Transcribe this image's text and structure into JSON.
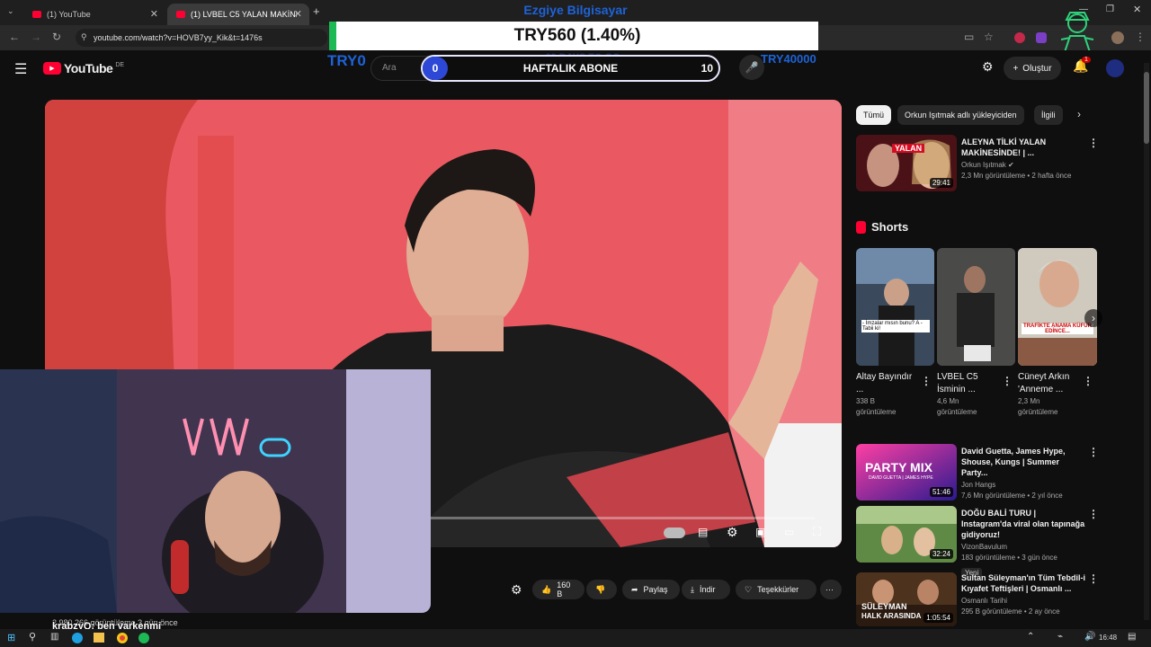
{
  "tabs": [
    {
      "label": "(1) YouTube"
    },
    {
      "label": "(1) LVBEL C5 YALAN MAKİNESİNE..."
    }
  ],
  "address": {
    "url": "youtube.com/watch?v=HOVB7yy_Kik&t=1476s"
  },
  "overlay": {
    "title": "Ezgiye Bilgisayar",
    "donation": "TRY560 (1.40%)",
    "try_left": "TRY0",
    "try_right": "TRY40000",
    "days_left": "69 DAYS TO GO",
    "subs_label": "HAFTALIK ABONE",
    "subs_current": "0",
    "subs_goal": "10"
  },
  "header": {
    "logo": "YouTube",
    "region": "DE",
    "search_placeholder": "Ara",
    "create_label": "Oluştur",
    "notif_count": "1"
  },
  "player": {
    "views_line": "2.980.266 görüntüleme  3 gün önce"
  },
  "actions": {
    "likes": "160 B",
    "share": "Paylaş",
    "download": "İndir",
    "thanks": "Teşekkürler"
  },
  "chips": [
    "Tümü",
    "Orkun Işıtmak adlı yükleyiciden",
    "İlgili"
  ],
  "recs_top": {
    "title": "ALEYNA TİLKİ YALAN MAKİNESİNDE! | ...",
    "channel": "Orkun Işıtmak",
    "meta": "2,3 Mn görüntüleme • 2 hafta önce",
    "duration": "29:41",
    "thumb_text": "YALAN"
  },
  "shorts": {
    "heading": "Shorts",
    "items": [
      {
        "title": "Altay Bayındır ...",
        "views": "338 B",
        "views_label": "görüntüleme",
        "caption": "- İmzalar mısın bunu? A - Tabii ki!"
      },
      {
        "title": "LVBEL C5 İsminin ...",
        "views": "4,6 Mn",
        "views_label": "görüntüleme",
        "caption": ""
      },
      {
        "title": "Cüneyt Arkın 'Anneme ...",
        "views": "2,3 Mn",
        "views_label": "görüntüleme",
        "caption": "TRAFİKTE ANAMA KÜFÜR EDİNCE..."
      }
    ]
  },
  "recs": [
    {
      "title": "David Guetta, James Hype, Shouse, Kungs | Summer Party...",
      "channel": "Jon Hangs",
      "meta": "7,6 Mn görüntüleme • 2 yıl önce",
      "duration": "51:46",
      "thumb_text": "PARTY MIX",
      "thumb_sub": "DAVID GUETTA | JAMES HYPE",
      "badge": ""
    },
    {
      "title": "DOĞU BALİ TURU | Instagram'da viral olan tapınağa gidiyoruz!",
      "channel": "VizonBavulum",
      "meta": "183 görüntüleme • 3 gün önce",
      "duration": "32:24",
      "thumb_text": "",
      "thumb_sub": "",
      "badge": "Yeni"
    },
    {
      "title": "Sultan Süleyman'ın Tüm Tebdil-i Kıyafet Teftişleri | Osmanlı ...",
      "channel": "Osmanlı Tarihi",
      "meta": "295 B görüntüleme • 2 ay önce",
      "duration": "1:05:54",
      "thumb_text": "SÜLEYMAN",
      "thumb_sub": "HALK ARASINDA",
      "badge": ""
    }
  ],
  "chat": {
    "user": "krabzyQ",
    "message": ": ben varkenmi"
  },
  "taskbar": {
    "time": "16:48"
  },
  "colors": {
    "accent": "#ff0033",
    "overlay_blue": "#1e63d8",
    "overlay_green": "#1db954"
  }
}
